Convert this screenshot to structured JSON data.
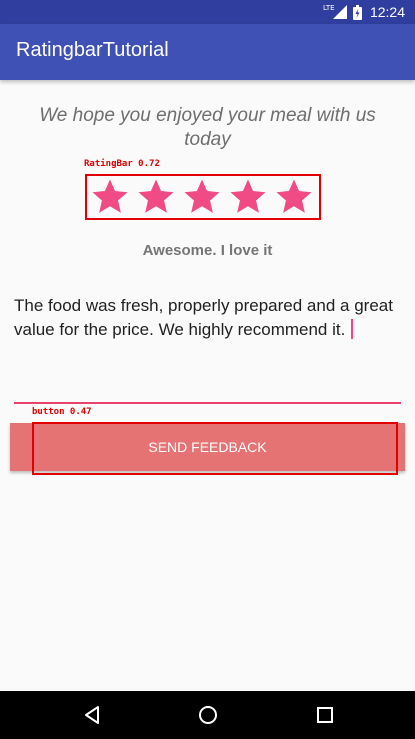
{
  "status_bar": {
    "network_label": "LTE",
    "clock": "12:24",
    "icons": [
      "signal-icon",
      "battery-icon"
    ]
  },
  "app_bar": {
    "title": "RatingbarTutorial"
  },
  "content": {
    "headline": "We hope you enjoyed your meal with us today",
    "rating": {
      "value": 5,
      "max": 5,
      "star_color": "#f04b84"
    },
    "rating_text": "Awesome. I love it",
    "feedback_value": "The food was fresh, properly prepared and a great value for the price. We highly recommend it.",
    "field_underline_color": "#e8436a",
    "send_label": "SEND FEEDBACK",
    "send_color": "#e57373"
  },
  "annotations": [
    {
      "label": "RatingBar 0.72",
      "color": "#e00000"
    },
    {
      "label": "button 0.47",
      "color": "#e00000"
    }
  ],
  "nav_bar": {
    "buttons": [
      "back-icon",
      "home-icon",
      "recents-icon"
    ]
  }
}
